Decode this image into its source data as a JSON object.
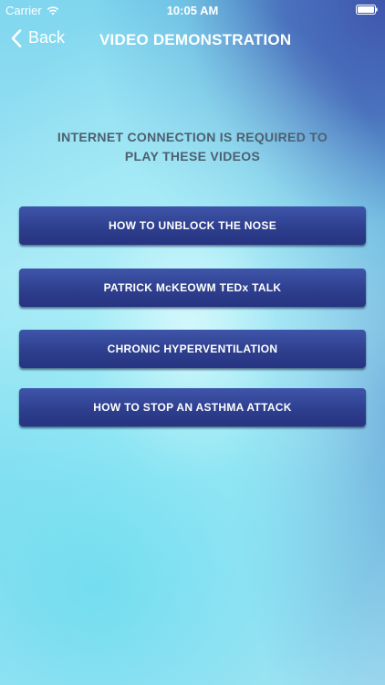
{
  "status_bar": {
    "carrier": "Carrier",
    "time": "10:05 AM"
  },
  "nav": {
    "back_label": "Back",
    "title": "VIDEO DEMONSTRATION"
  },
  "notice": {
    "line1": "INTERNET CONNECTION IS REQUIRED TO",
    "line2": "PLAY THESE VIDEOS"
  },
  "videos": [
    {
      "label": "HOW TO UNBLOCK THE NOSE"
    },
    {
      "label": "PATRICK McKEOWM TEDx TALK"
    },
    {
      "label": "CHRONIC HYPERVENTILATION"
    },
    {
      "label": "HOW TO STOP AN ASTHMA ATTACK"
    }
  ],
  "colors": {
    "button_bg": "#2e3f8e",
    "text_on_button": "#ffffff",
    "notice_text": "#4d6070"
  },
  "icons": {
    "wifi": "wifi-icon",
    "battery": "battery-icon",
    "back": "chevron-left-icon"
  }
}
